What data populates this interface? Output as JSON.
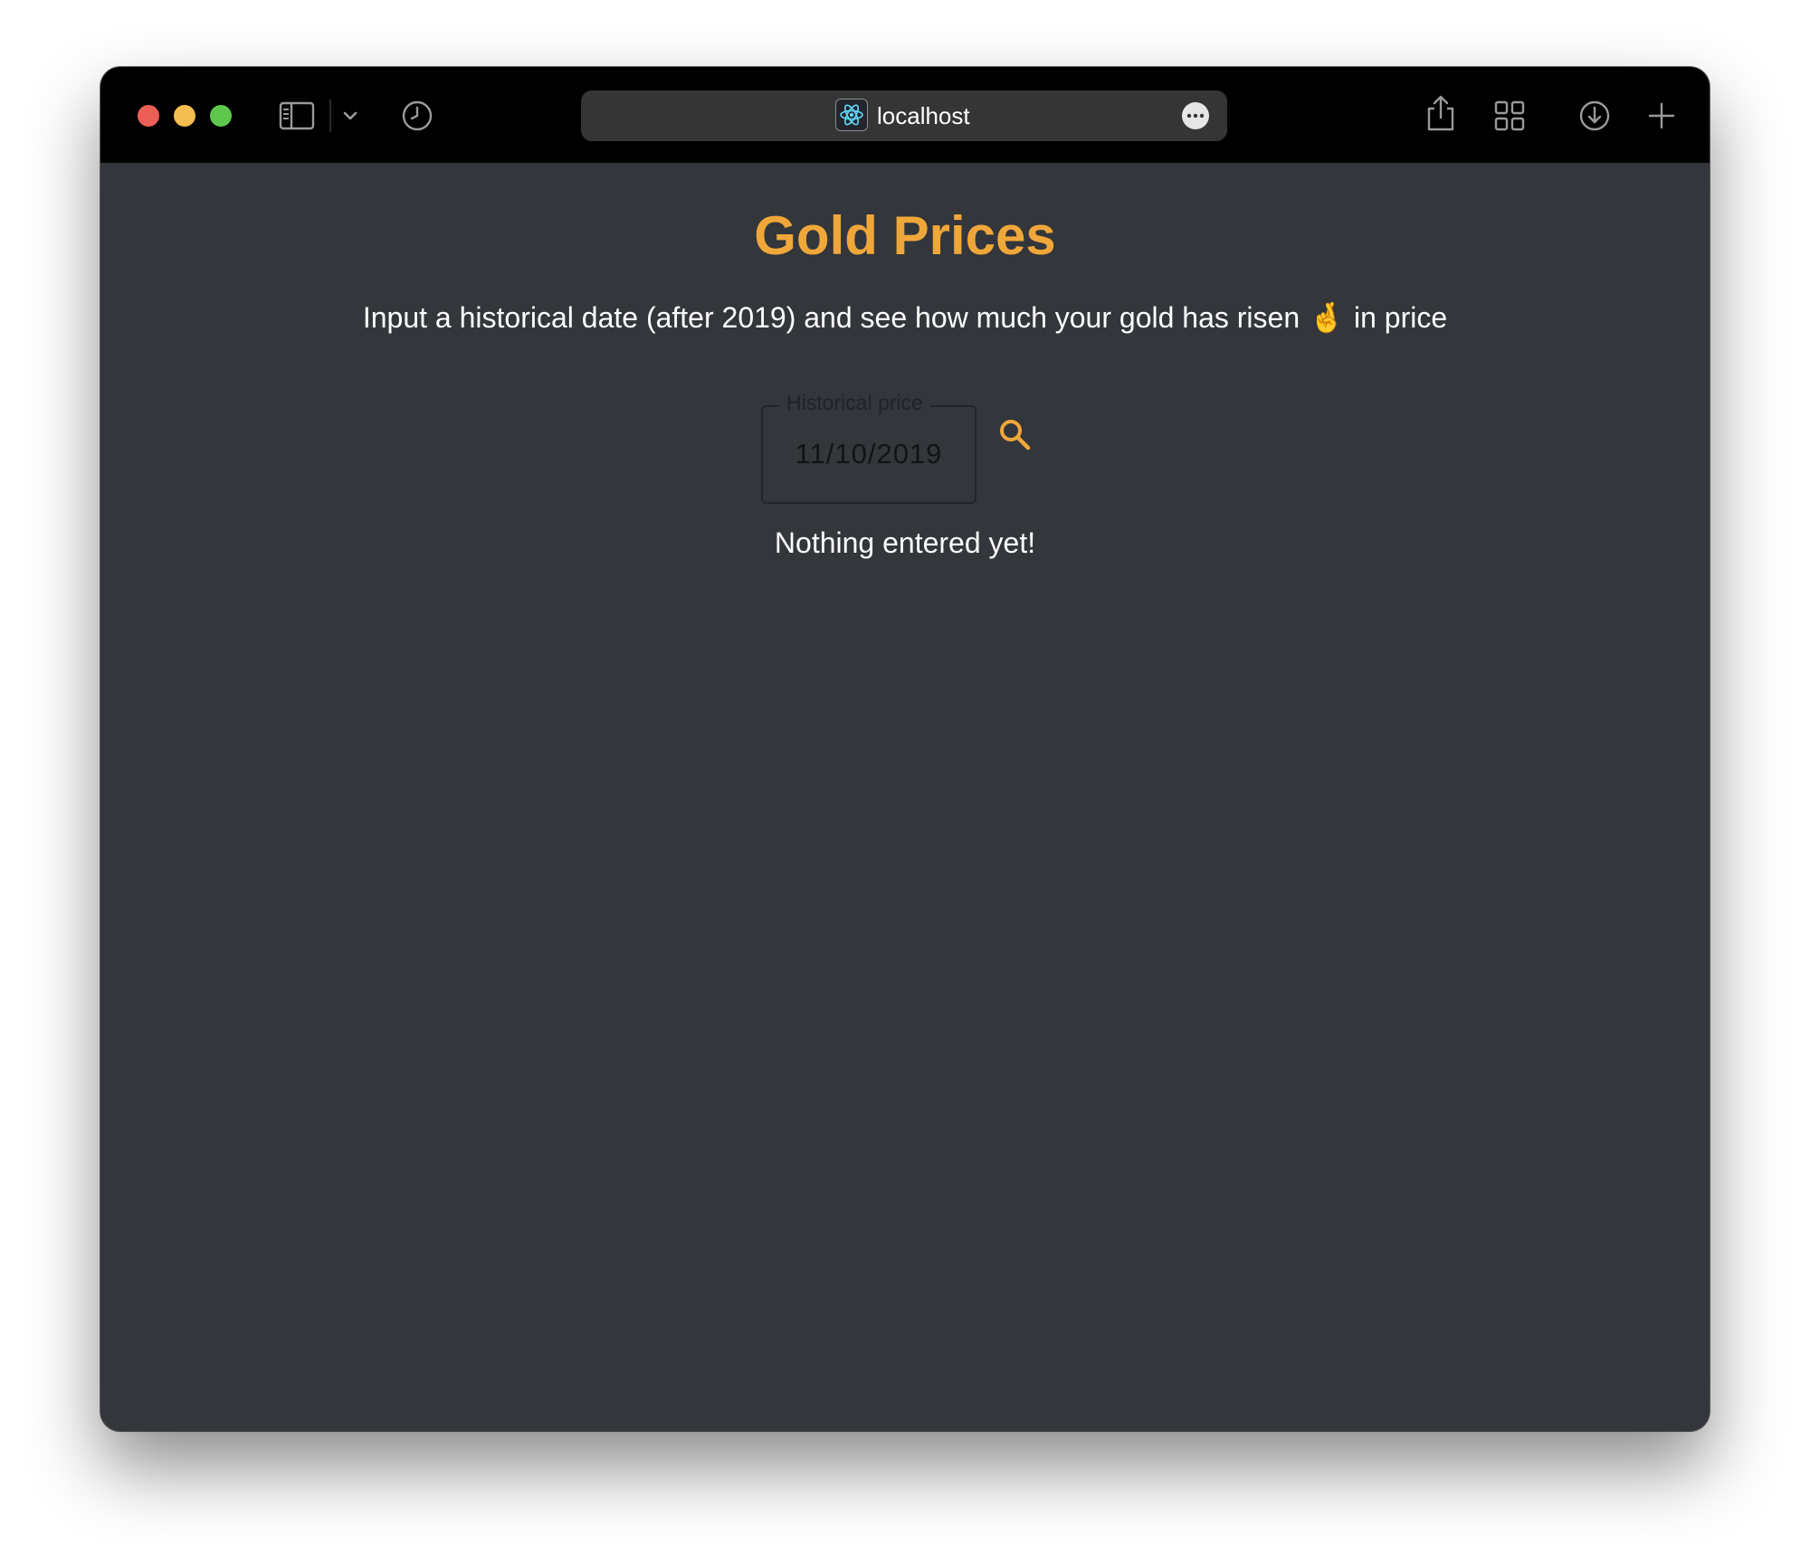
{
  "browser": {
    "url": "localhost",
    "icons": {
      "close": "traffic-close",
      "minimize": "traffic-minimize",
      "zoom": "traffic-zoom",
      "sidebar": "sidebar-icon",
      "dropdown": "chevron-down-icon",
      "history": "clock-icon",
      "site": "react-atom-icon",
      "more": "ellipsis-icon",
      "share": "share-icon",
      "tabs": "tab-grid-icon",
      "downloads": "download-icon",
      "new_tab": "plus-icon"
    }
  },
  "page": {
    "title": "Gold Prices",
    "subtitle_before": "Input a historical date (after 2019) and see how much your gold has risen",
    "subtitle_emoji": "🤞",
    "subtitle_after": "in price",
    "field_label": "Historical price",
    "field_value": "11/10/2019",
    "status": "Nothing entered yet!"
  },
  "colors": {
    "accent": "#f0a73a",
    "background": "#33363b",
    "toolbar": "#000000",
    "text": "#ffffff"
  }
}
